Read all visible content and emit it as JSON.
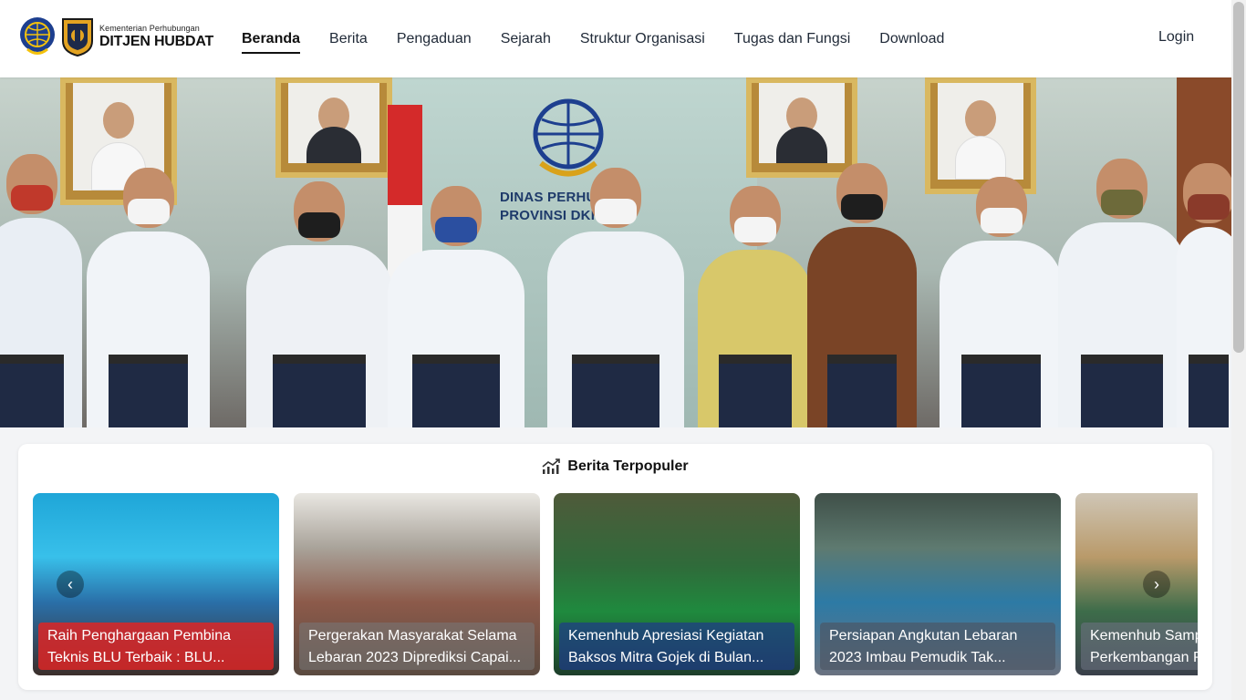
{
  "header": {
    "brand_small": "Kementerian Perhubungan",
    "brand_big": "DITJEN HUBDAT",
    "nav": [
      {
        "label": "Beranda",
        "active": true
      },
      {
        "label": "Berita",
        "active": false
      },
      {
        "label": "Pengaduan",
        "active": false
      },
      {
        "label": "Sejarah",
        "active": false
      },
      {
        "label": "Struktur Organisasi",
        "active": false
      },
      {
        "label": "Tugas dan Fungsi",
        "active": false
      },
      {
        "label": "Download",
        "active": false
      }
    ],
    "login": "Login"
  },
  "hero": {
    "wall_text_line1": "DINAS PERHUB",
    "wall_text_line2": "PROVINSI DKI JA"
  },
  "popular": {
    "title": "Berita Terpopuler",
    "icon": "trending-chart-icon",
    "cards": [
      {
        "line1": "Raih Penghargaan Pembina",
        "line2": "Teknis BLU Terbaik : BLU...",
        "caption_color": "#dc2626"
      },
      {
        "line1": "Pergerakan Masyarakat Selama",
        "line2": "Lebaran 2023 Diprediksi Capai...",
        "caption_color": "#9ca3af"
      },
      {
        "line1": "Kemenhub Apresiasi Kegiatan",
        "line2": "Baksos Mitra Gojek di Bulan...",
        "caption_color": "#1e3a8a"
      },
      {
        "line1": "Persiapan Angkutan Lebaran",
        "line2": "2023 Imbau Pemudik Tak...",
        "caption_color": "#4b5563"
      },
      {
        "line1": "Kemenhub Samp",
        "line2": "Perkembangan P",
        "caption_color": "#6b7280"
      }
    ],
    "prev_icon": "chevron-left-icon",
    "next_icon": "chevron-right-icon"
  },
  "colors": {
    "accent": "#111111",
    "nav_text": "#1f2937"
  }
}
